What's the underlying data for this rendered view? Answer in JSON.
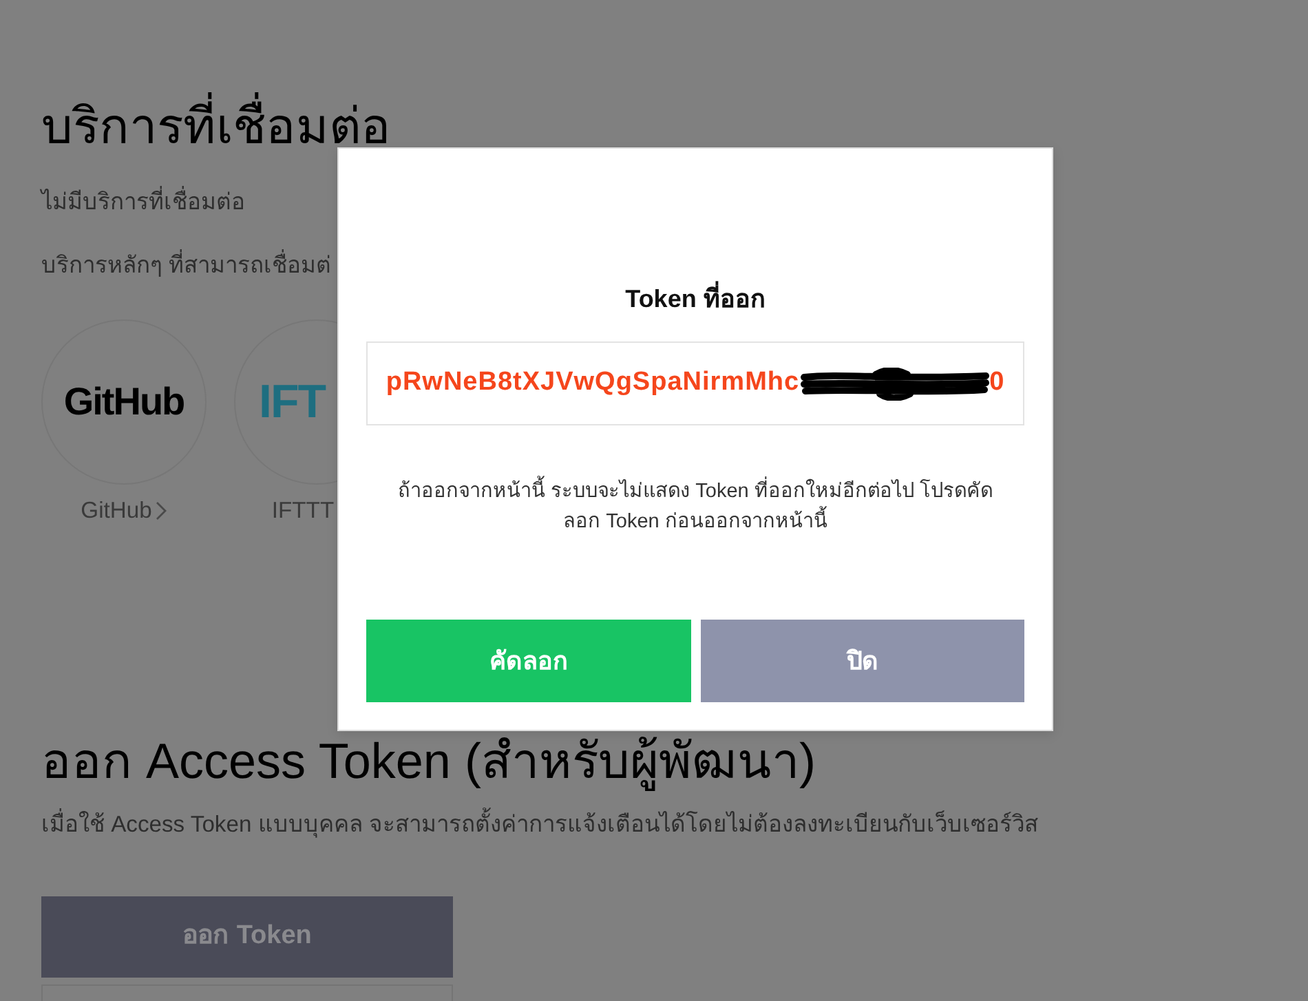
{
  "page": {
    "connected_services": {
      "title": "บริการที่เชื่อมต่อ",
      "empty_message": "ไม่มีบริการที่เชื่อมต่อ",
      "featured_caption": "บริการหลักๆ ที่สามารถเชื่อมต่",
      "services": [
        {
          "kind": "github",
          "logo_text": "GitHub",
          "label": "GitHub",
          "link_arrow": true
        },
        {
          "kind": "ifttt",
          "logo_text": "IFT",
          "label": "IFTTT",
          "link_arrow": false
        }
      ]
    },
    "access_token": {
      "title": "ออก Access Token (สำหรับผู้พัฒนา)",
      "description": "เมื่อใช้ Access Token แบบบุคคล จะสามารถตั้งค่าการแจ้งเตือนได้โดยไม่ต้องลงทะเบียนกับเว็บเซอร์วิส",
      "buttons": [
        {
          "kind": "filled",
          "label": "ออก Token"
        },
        {
          "kind": "outlined"
        }
      ]
    }
  },
  "dialog": {
    "title": "Token ที่ออก",
    "token": {
      "text_before": "pRwNeB8tXJVwQgSpaNirmMhc",
      "redacted": true,
      "text_after": "0"
    },
    "message": "ถ้าออกจากหน้านี้ ระบบจะไม่แสดง Token ที่ออกใหม่อีกต่อไป โปรดคัดลอก Token ก่อนออกจากหน้านี้",
    "buttons": [
      {
        "kind": "primary",
        "label": "คัดลอก"
      },
      {
        "kind": "secondary",
        "label": "ปิด"
      }
    ]
  }
}
